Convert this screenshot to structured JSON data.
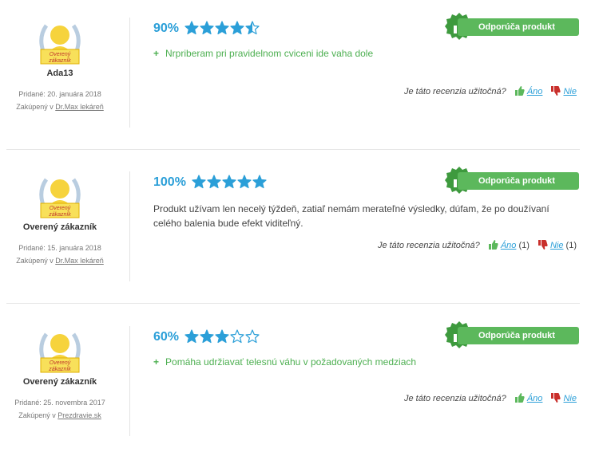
{
  "colors": {
    "accent": "#2b9fd8",
    "green": "#5cb85c",
    "red": "#c9302c",
    "star": "#2b9fd8",
    "badge_gold": "#f6d33c"
  },
  "recommend_label": "Odporúča produkt",
  "useful_question": "Je táto recenzia užitočná?",
  "yes_label": "Áno",
  "no_label": "Nie",
  "badge_text": [
    "Overený",
    "zákazník"
  ],
  "reviews": [
    {
      "author": "Ada13",
      "date": "Pridané: 20. januára 2018",
      "purchased_prefix": "Zakúpený v",
      "store": "Dr.Max lekáreň",
      "percent": "90%",
      "rating": 4.5,
      "pro": "Nrpriberam pri pravidelnom cviceni ide vaha dole",
      "yes_count": "",
      "no_count": ""
    },
    {
      "author": "Overený zákazník",
      "date": "Pridané: 15. januára 2018",
      "purchased_prefix": "Zakúpený v",
      "store": "Dr.Max lekáreň",
      "percent": "100%",
      "rating": 5,
      "text": "Produkt užívam len necelý týždeň, zatiaľ nemám merateľné výsledky, dúfam, že po doužívaní celého balenia bude efekt viditeľný.",
      "yes_count": "(1)",
      "no_count": "(1)"
    },
    {
      "author": "Overený zákazník",
      "date": "Pridané: 25. novembra 2017",
      "purchased_prefix": "Zakúpený v",
      "store": "Prezdravie.sk",
      "percent": "60%",
      "rating": 3,
      "pro": "Pomáha udržiavať telesnú váhu v požadovaných medziach",
      "yes_count": "",
      "no_count": ""
    }
  ]
}
